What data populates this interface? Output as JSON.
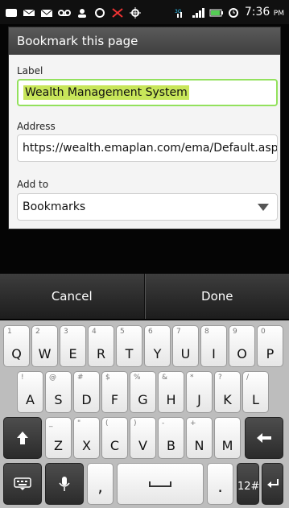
{
  "status_bar": {
    "time": "7:36",
    "ampm": "PM"
  },
  "dialog": {
    "title": "Bookmark this page",
    "label_field": {
      "label": "Label",
      "value": "Wealth Management System"
    },
    "address_field": {
      "label": "Address",
      "value": "https://wealth.emaplan.com/ema/Default.asp"
    },
    "add_to": {
      "label": "Add to",
      "selected": "Bookmarks"
    }
  },
  "buttons": {
    "cancel": "Cancel",
    "done": "Done"
  },
  "keyboard": {
    "row1": [
      {
        "main": "Q",
        "hint": "1"
      },
      {
        "main": "W",
        "hint": "2"
      },
      {
        "main": "E",
        "hint": "3"
      },
      {
        "main": "R",
        "hint": "4"
      },
      {
        "main": "T",
        "hint": "5"
      },
      {
        "main": "Y",
        "hint": "6"
      },
      {
        "main": "U",
        "hint": "7"
      },
      {
        "main": "I",
        "hint": "8"
      },
      {
        "main": "O",
        "hint": "9"
      },
      {
        "main": "P",
        "hint": "0"
      }
    ],
    "row2": [
      {
        "main": "A",
        "hint": "!"
      },
      {
        "main": "S",
        "hint": "@"
      },
      {
        "main": "D",
        "hint": "#"
      },
      {
        "main": "F",
        "hint": "$"
      },
      {
        "main": "G",
        "hint": "%"
      },
      {
        "main": "H",
        "hint": "&"
      },
      {
        "main": "J",
        "hint": "*"
      },
      {
        "main": "K",
        "hint": "?"
      },
      {
        "main": "L",
        "hint": "/"
      }
    ],
    "row3": [
      {
        "main": "Z",
        "hint": "_"
      },
      {
        "main": "X",
        "hint": "\""
      },
      {
        "main": "C",
        "hint": "("
      },
      {
        "main": "V",
        "hint": ")"
      },
      {
        "main": "B",
        "hint": "-"
      },
      {
        "main": "N",
        "hint": "+"
      },
      {
        "main": "M",
        "hint": ""
      }
    ],
    "row4": {
      "comma": ",",
      "period": ".",
      "numbers": "12#"
    }
  },
  "colors": {
    "focus_border": "#93e15d",
    "selection": "#c8e65a"
  }
}
